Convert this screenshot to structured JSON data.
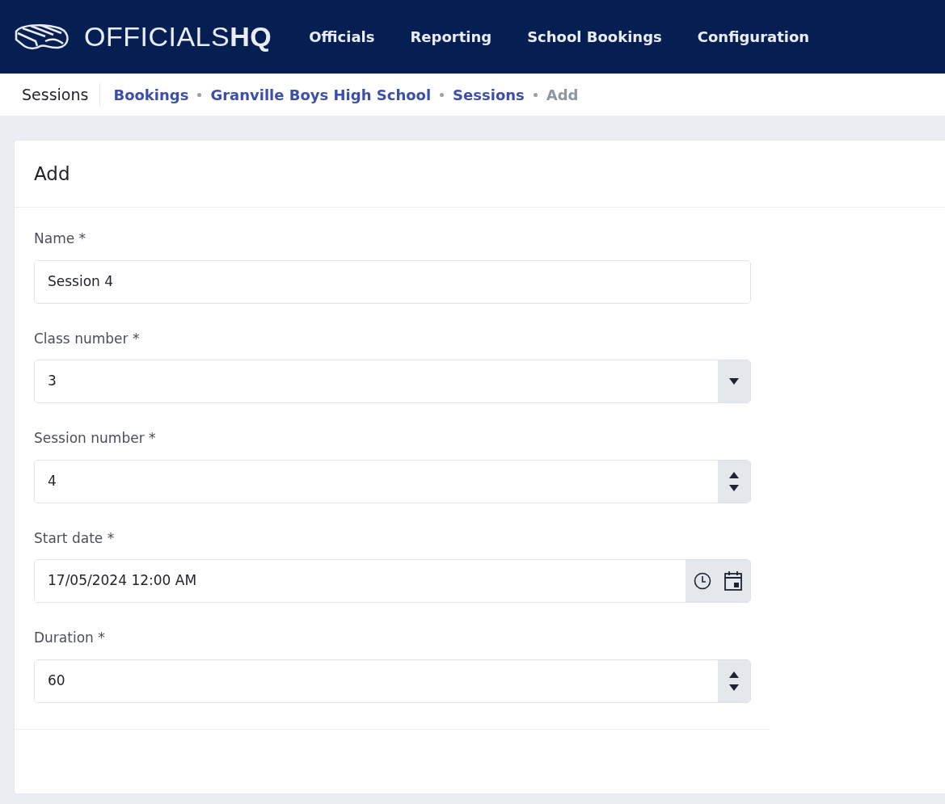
{
  "brand": {
    "logo_text": "OFFICIALS**HQ**"
  },
  "nav": [
    {
      "label": "Officials"
    },
    {
      "label": "Reporting"
    },
    {
      "label": "School Bookings"
    },
    {
      "label": "Configuration"
    }
  ],
  "page_title": "Sessions",
  "breadcrumbs": [
    {
      "label": "Bookings",
      "active": false
    },
    {
      "label": "Granville Boys High School",
      "active": false
    },
    {
      "label": "Sessions",
      "active": false
    },
    {
      "label": "Add",
      "active": true
    }
  ],
  "card": {
    "title": "Add",
    "fields": [
      {
        "kind": "text",
        "label": "Name *",
        "value": "Session 4"
      },
      {
        "kind": "select",
        "label": "Class number *",
        "value": "3"
      },
      {
        "kind": "number",
        "label": "Session number *",
        "value": "4"
      },
      {
        "kind": "datetime",
        "label": "Start date *",
        "value": "17/05/2024 12:00 AM"
      },
      {
        "kind": "number",
        "label": "Duration *",
        "value": "60"
      }
    ]
  }
}
